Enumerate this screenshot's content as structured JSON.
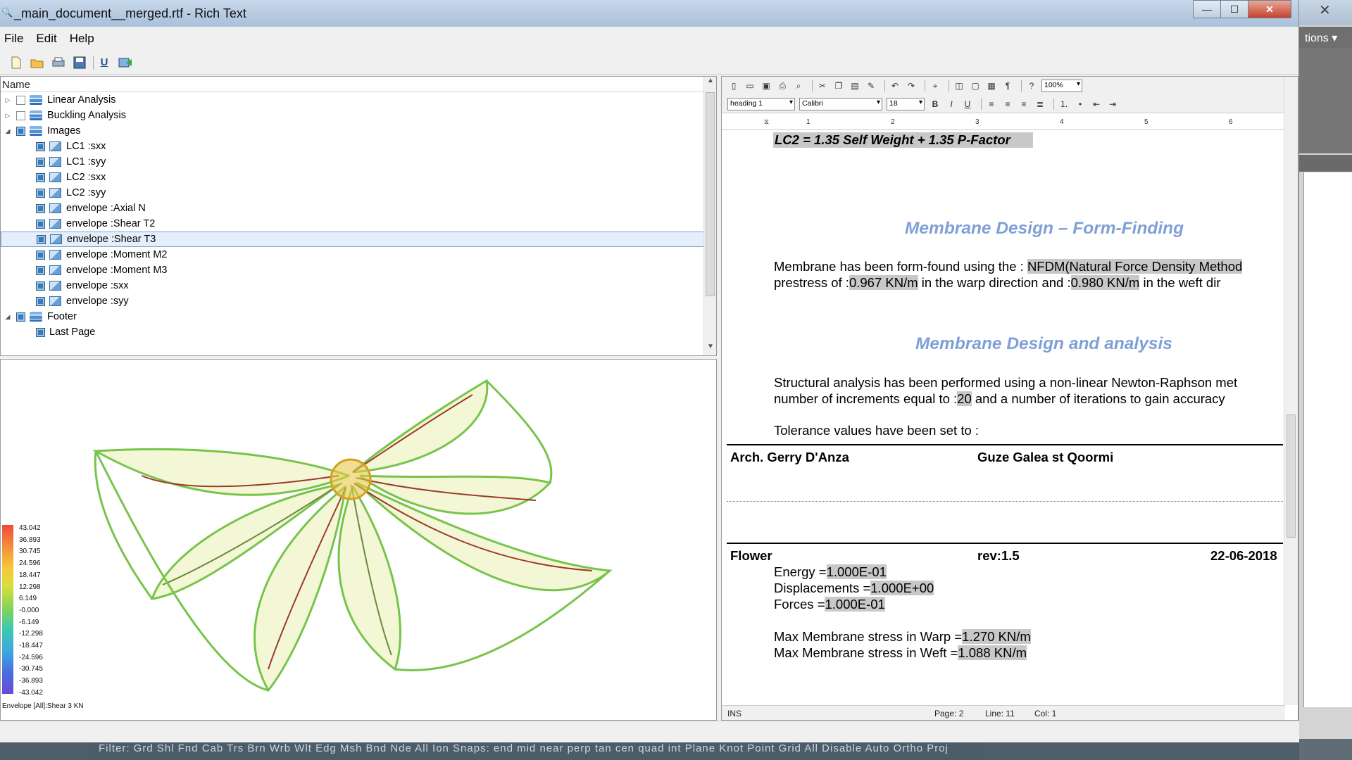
{
  "window": {
    "title": "_main_document__merged.rtf - Rich Text",
    "buttons": {
      "minimize": "—",
      "maximize": "☐",
      "close": "✕"
    }
  },
  "menu": {
    "file": "File",
    "edit": "Edit",
    "help": "Help"
  },
  "toolbar_icons": [
    "new-file-icon",
    "open-folder-icon",
    "print-icon",
    "save-icon",
    "underline-icon",
    "export-icon"
  ],
  "tree": {
    "header": "Name",
    "nodes": {
      "linear_analysis": "Linear Analysis",
      "buckling_analysis": "Buckling Analysis",
      "images": "Images",
      "footer": "Footer"
    },
    "images_children": [
      "LC1 :sxx",
      "LC1 :syy",
      "LC2 :sxx",
      "LC2 :syy",
      "envelope :Axial N",
      "envelope :Shear T2",
      "envelope :Shear T3",
      "envelope :Moment M2",
      "envelope :Moment M3",
      "envelope :sxx",
      "envelope :syy"
    ],
    "selected_index": 6,
    "footer_children": [
      "Last Page"
    ]
  },
  "legend": {
    "values": [
      "43.042",
      "36.893",
      "30.745",
      "24.596",
      "18.447",
      "12.298",
      "6.149",
      "-0.000",
      "-6.149",
      "-12.298",
      "-18.447",
      "-24.596",
      "-30.745",
      "-36.893",
      "-43.042"
    ],
    "caption": "Envelope [All]:Shear 3 KN"
  },
  "editor": {
    "zoom": "100%",
    "style": "heading 1",
    "font": "Calibri",
    "size": "18",
    "ruler_numbers": [
      "1",
      "2",
      "3",
      "4",
      "5",
      "6"
    ],
    "doc": {
      "lc2": "LC2  = 1.35 Self Weight + 1.35 P-Factor",
      "heading1": "Membrane Design – Form-Finding",
      "p1_a": "Membrane has been form-found using the : ",
      "p1_hl": "NFDM(Natural Force Density Method",
      "p2_a": "prestress of  :",
      "p2_hl1": "0.967 KN/m",
      "p2_b": " in the warp direction  and :",
      "p2_hl2": "0.980 KN/m",
      "p2_c": "  in the weft dir",
      "heading2": "Membrane Design and analysis",
      "p3": "Structural analysis has been performed using a non-linear Newton-Raphson met",
      "p4_a": "number of increments equal to  :",
      "p4_hl": "20",
      "p4_b": "  and a number of iterations to gain accuracy",
      "p5": "Tolerance values have been set to :",
      "hdr_left": "Arch. Gerry D'Anza",
      "hdr_right": "Guze Galea st Qoormi",
      "ftr_left": "Flower",
      "ftr_mid": "rev:1.5",
      "ftr_right": "22-06-2018",
      "energy_label": "Energy  =",
      "energy_val": "1.000E-01",
      "disp_label": "Displacements =",
      "disp_val": "1.000E+00",
      "forces_label": "Forces  =",
      "forces_val": "1.000E-01",
      "warp_label": "Max Membrane stress in Warp  =",
      "warp_val": "1.270 KN/m",
      "weft_label": "Max Membrane stress in Weft   =",
      "weft_val": "1.088 KN/m"
    },
    "status": {
      "mode": "INS",
      "page": "Page: 2",
      "line": "Line: 11",
      "col": "Col: 1"
    }
  },
  "background": {
    "right_title": "tions ▾",
    "taskbar": "Filter: Grd  Shl  Fnd  Cab  Trs  Brn  Wrb  Wlt  Edg  Msh  Bnd  Nde   All   Ion   Snaps: end  mid  near  perp  tan  cen  quad  int  Plane  Knot  Point  Grid   All   Disable   Auto   Ortho   Proj"
  }
}
